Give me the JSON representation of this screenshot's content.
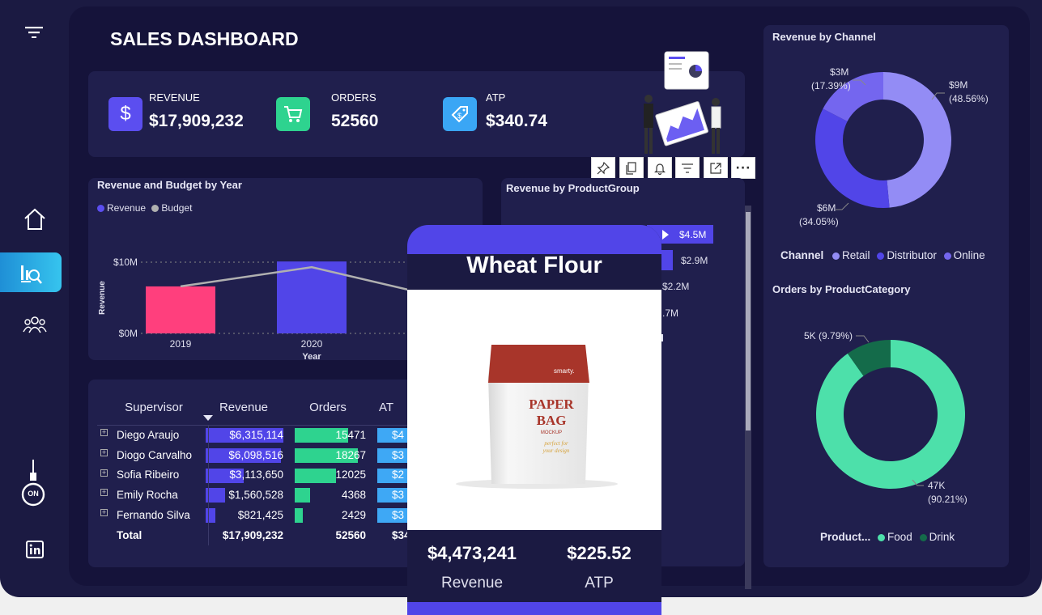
{
  "header": {
    "title": "SALES DASHBOARD"
  },
  "kpis": [
    {
      "label": "REVENUE",
      "value": "$17,909,232",
      "icon": "dollar-icon",
      "color": "#5b4ef0"
    },
    {
      "label": "ORDERS",
      "value": "52560",
      "icon": "cart-icon",
      "color": "#2ed38f"
    },
    {
      "label": "ATP",
      "value": "$340.74",
      "icon": "tag-icon",
      "color": "#3aa6f5"
    }
  ],
  "rail": {
    "items": [
      "filter-icon",
      "home-icon",
      "analytics-icon",
      "people-icon",
      "power-switch-icon",
      "linkedin-icon"
    ],
    "on_label": "ON"
  },
  "toolbar": [
    "pin-icon",
    "copy-icon",
    "bell-icon",
    "filter-icon",
    "focus-mode-icon",
    "more-icon"
  ],
  "rev_budget": {
    "title": "Revenue and Budget by Year",
    "legend": [
      "Revenue",
      "Budget"
    ],
    "ylabel": "Revenue",
    "xlabel": "Year",
    "yticks": [
      "$10M",
      "$0M"
    ],
    "categories": [
      "2019",
      "2020"
    ]
  },
  "rev_product": {
    "title": "Revenue by ProductGroup",
    "labels": [
      "$4.5M",
      "$2.9M",
      "$2.2M",
      ".7M"
    ]
  },
  "channel": {
    "title": "Revenue by Channel",
    "legend_title": "Channel",
    "legend": [
      "Retail",
      "Distributor",
      "Online"
    ],
    "labels": [
      {
        "value": "$9M",
        "pct": "(48.56%)"
      },
      {
        "value": "$6M",
        "pct": "(34.05%)"
      },
      {
        "value": "$3M",
        "pct": "(17.39%)"
      }
    ]
  },
  "category": {
    "title": "Orders by ProductCategory",
    "legend_title": "Product...",
    "legend": [
      "Food",
      "Drink"
    ],
    "labels": [
      {
        "value": "47K",
        "pct": "(90.21%)"
      },
      {
        "value": "5K (9.79%)",
        "pct": ""
      }
    ]
  },
  "supervisors": {
    "headers": [
      "Supervisor",
      "Revenue",
      "Orders",
      "AT"
    ],
    "rows": [
      {
        "name": "Diego Araujo",
        "revenue": "$6,315,114",
        "orders": "15471",
        "atp": "$4"
      },
      {
        "name": "Diogo Carvalho",
        "revenue": "$6,098,516",
        "orders": "18267",
        "atp": "$3"
      },
      {
        "name": "Sofia Ribeiro",
        "revenue": "$3,113,650",
        "orders": "12025",
        "atp": "$2"
      },
      {
        "name": "Emily Rocha",
        "revenue": "$1,560,528",
        "orders": "4368",
        "atp": "$3"
      },
      {
        "name": "Fernando Silva",
        "revenue": "$821,425",
        "orders": "2429",
        "atp": "$3"
      }
    ],
    "total": {
      "label": "Total",
      "revenue": "$17,909,232",
      "orders": "52560",
      "atp": "$34"
    }
  },
  "tooltip": {
    "product": "Wheat Flour",
    "revenue_value": "$4,473,241",
    "revenue_label": "Revenue",
    "atp_value": "$225.52",
    "atp_label": "ATP",
    "bag": {
      "brand": "smarty.",
      "line1": "PAPER",
      "line2": "BAG",
      "line3": "MOCKUP",
      "script1": "perfect for",
      "script2": "your design"
    }
  },
  "chart_data": [
    {
      "type": "bar",
      "title": "Revenue and Budget by Year",
      "categories": [
        "2019",
        "2020"
      ],
      "series": [
        {
          "name": "Revenue",
          "values": [
            6.6,
            10.1
          ]
        },
        {
          "name": "Budget",
          "values": [
            6.6,
            9.3
          ]
        }
      ],
      "xlabel": "Year",
      "ylabel": "Revenue",
      "ylim": [
        0,
        10
      ]
    },
    {
      "type": "bar",
      "title": "Revenue by ProductGroup",
      "values": [
        4.5,
        2.9,
        2.2
      ]
    },
    {
      "type": "pie",
      "title": "Revenue by Channel",
      "categories": [
        "Retail",
        "Distributor",
        "Online"
      ],
      "values": [
        48.56,
        34.05,
        17.39
      ]
    },
    {
      "type": "pie",
      "title": "Orders by ProductCategory",
      "categories": [
        "Food",
        "Drink"
      ],
      "values": [
        90.21,
        9.79
      ]
    }
  ],
  "colors": {
    "revenue": "#5b4ef0",
    "orders": "#2ed38f",
    "atp": "#3ea8f5",
    "retail": "#938cf5",
    "distributor": "#5145e8",
    "online": "#7466ef",
    "food": "#4de0aa",
    "drink": "#146b4a",
    "bar2019": "#ff3f7d",
    "budget": "#b0b0b0"
  }
}
